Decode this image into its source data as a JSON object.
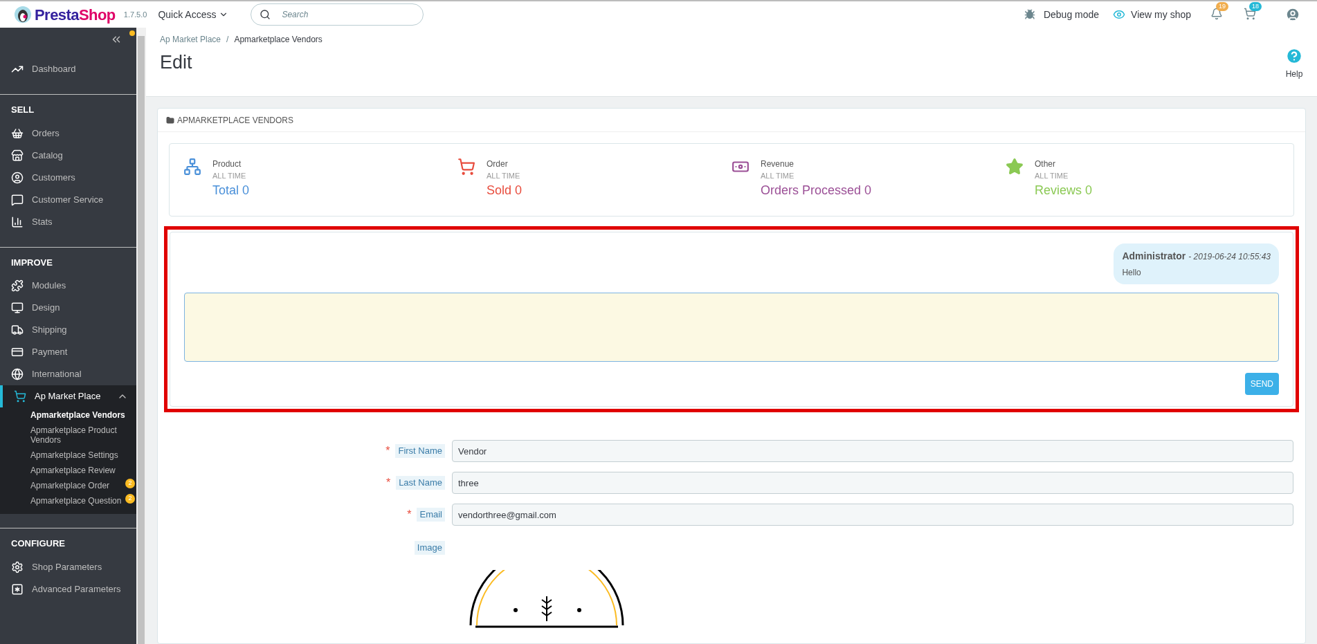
{
  "header": {
    "brand": {
      "first": "Presta",
      "second": "Shop"
    },
    "version": "1.7.5.0",
    "quick_access": "Quick Access",
    "search": {
      "placeholder": "Search"
    },
    "debug_mode": "Debug mode",
    "view_shop": "View my shop",
    "notifications": [
      {
        "kind": "bell",
        "count": "19",
        "color": "#f0ad4e"
      },
      {
        "kind": "cart",
        "count": "18",
        "color": "#25b9d7"
      }
    ]
  },
  "sidebar": {
    "sections": [
      {
        "items": [
          {
            "kind": "dashboard",
            "label": "Dashboard",
            "selected": false,
            "expanded": false
          }
        ]
      },
      {
        "title": "SELL",
        "items": [
          {
            "kind": "orders",
            "label": "Orders",
            "selected": false,
            "expanded": false
          },
          {
            "kind": "catalog",
            "label": "Catalog",
            "selected": false,
            "expanded": false
          },
          {
            "kind": "customers",
            "label": "Customers",
            "selected": false,
            "expanded": false
          },
          {
            "kind": "service",
            "label": "Customer Service",
            "selected": false,
            "expanded": false
          },
          {
            "kind": "stats",
            "label": "Stats",
            "selected": false,
            "expanded": false
          }
        ]
      },
      {
        "title": "IMPROVE",
        "items": [
          {
            "kind": "modules",
            "label": "Modules",
            "selected": false,
            "expanded": false
          },
          {
            "kind": "design",
            "label": "Design",
            "selected": false,
            "expanded": false
          },
          {
            "kind": "shipping",
            "label": "Shipping",
            "selected": false,
            "expanded": false
          },
          {
            "kind": "payment",
            "label": "Payment",
            "selected": false,
            "expanded": false
          },
          {
            "kind": "international",
            "label": "International",
            "selected": false,
            "expanded": false
          },
          {
            "kind": "market",
            "label": "Ap Market Place",
            "selected": true,
            "expanded": true,
            "children": [
              {
                "label": "Apmarketplace Vendors",
                "selected": true
              },
              {
                "label": "Apmarketplace Product Vendors",
                "selected": false
              },
              {
                "label": "Apmarketplace Settings",
                "selected": false
              },
              {
                "label": "Apmarketplace Review",
                "selected": false
              },
              {
                "label": "Apmarketplace Order",
                "selected": false,
                "badge": "2"
              },
              {
                "label": "Apmarketplace Question",
                "selected": false,
                "badge": "2"
              }
            ]
          }
        ]
      },
      {
        "title": "CONFIGURE",
        "items": [
          {
            "kind": "shop_params",
            "label": "Shop Parameters",
            "selected": false,
            "expanded": false
          },
          {
            "kind": "advanced",
            "label": "Advanced Parameters",
            "selected": false,
            "expanded": false
          }
        ]
      }
    ]
  },
  "breadcrumb": {
    "items": [
      "Ap Market Place",
      "Apmarketplace Vendors"
    ],
    "separator": "/"
  },
  "page_title": "Edit",
  "help": "Help",
  "panel": {
    "title": "APMARKETPLACE VENDORS",
    "stats": [
      {
        "kind": "product",
        "label": "Product",
        "period": "ALL TIME",
        "value": "Total 0",
        "color": "#4a90d9"
      },
      {
        "kind": "order",
        "label": "Order",
        "period": "ALL TIME",
        "value": "Sold 0",
        "color": "#e84c3d"
      },
      {
        "kind": "revenue",
        "label": "Revenue",
        "period": "ALL TIME",
        "value": "Orders Processed 0",
        "color": "#9b4f96"
      },
      {
        "kind": "other",
        "label": "Other",
        "period": "ALL TIME",
        "value": "Reviews 0",
        "color": "#8bc954"
      }
    ],
    "chat": {
      "messages": [
        {
          "author": "Administrator",
          "time": "- 2019-06-24 10:55:43",
          "text": "Hello"
        }
      ],
      "send": "SEND"
    },
    "form": {
      "fields": [
        {
          "label": "First Name",
          "required_mark": "*",
          "value": "Vendor"
        },
        {
          "label": "Last Name",
          "required_mark": "*",
          "value": "three"
        },
        {
          "label": "Email",
          "required_mark": "*",
          "value": "vendorthree@gmail.com"
        }
      ],
      "image_label": "Image"
    }
  }
}
